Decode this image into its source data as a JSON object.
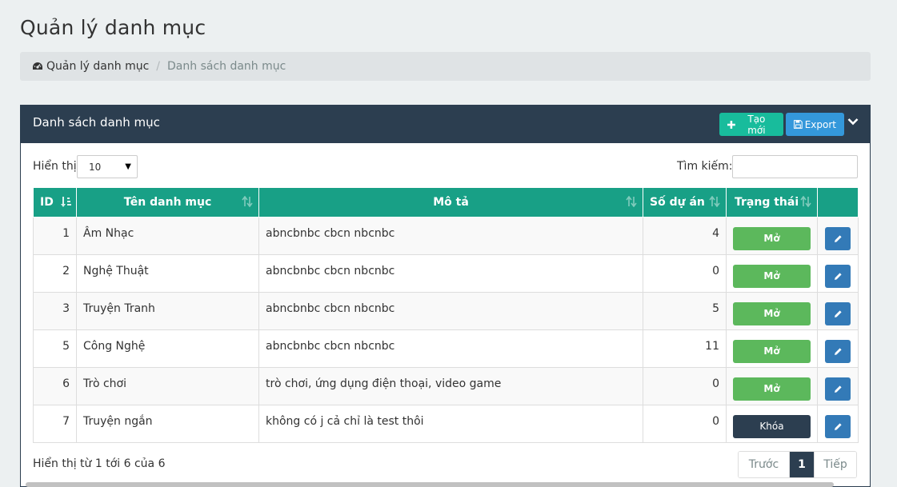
{
  "page": {
    "title": "Quản lý danh mục"
  },
  "breadcrumb": {
    "home": "Quản lý danh mục",
    "current": "Danh sách danh mục"
  },
  "panel": {
    "title": "Danh sách danh mục",
    "create_label": "Tạo mới",
    "export_label": "Export"
  },
  "controls": {
    "length_label": "Hiển thị",
    "length_value": "10",
    "search_label": "Tìm kiếm:",
    "search_value": ""
  },
  "table": {
    "headers": [
      "ID",
      "Tên danh mục",
      "Mô tả",
      "Số dự án",
      "Trạng thái",
      ""
    ],
    "rows": [
      {
        "id": "1",
        "name": "Âm Nhạc",
        "desc": "abncbnbc cbcn nbcnbc",
        "count": "4",
        "status": "Mở",
        "state": "open"
      },
      {
        "id": "2",
        "name": "Nghệ Thuật",
        "desc": "abncbnbc cbcn nbcnbc",
        "count": "0",
        "status": "Mở",
        "state": "open"
      },
      {
        "id": "3",
        "name": "Truyện Tranh",
        "desc": "abncbnbc cbcn nbcnbc",
        "count": "5",
        "status": "Mở",
        "state": "open"
      },
      {
        "id": "5",
        "name": "Công Nghệ",
        "desc": "abncbnbc cbcn nbcnbc",
        "count": "11",
        "status": "Mở",
        "state": "open"
      },
      {
        "id": "6",
        "name": "Trò chơi",
        "desc": "trò chơi, ứng dụng điện thoại, video game",
        "count": "0",
        "status": "Mở",
        "state": "open"
      },
      {
        "id": "7",
        "name": "Truyện ngắn",
        "desc": "không có j cả chỉ là test thôi",
        "count": "0",
        "status": "Khóa",
        "state": "locked"
      }
    ]
  },
  "footer": {
    "info": "Hiển thị từ 1 tới 6 của 6",
    "prev_label": "Trước",
    "current_page": "1",
    "next_label": "Tiếp"
  },
  "colors": {
    "header_bg": "#2c3e50",
    "table_header": "#18a086",
    "open_status": "#5cb85c",
    "locked_status": "#2c3e50",
    "create_button": "#18bc9c",
    "export_button": "#3498db",
    "edit_button": "#337ab7"
  },
  "icons": {
    "breadcrumb": "dashboard-icon",
    "create": "plus-icon",
    "export": "floppy-icon",
    "collapse": "chevron-down-icon",
    "edit": "pencil-icon",
    "sort": "sort-icon"
  }
}
